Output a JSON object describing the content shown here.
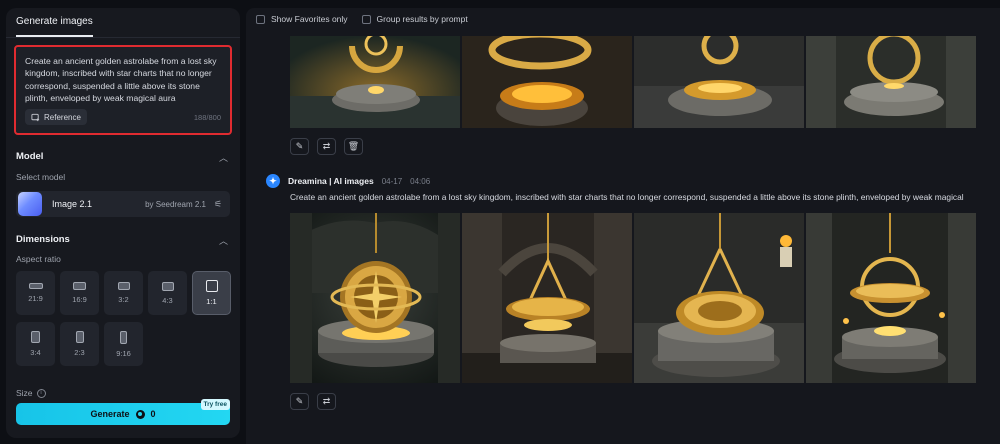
{
  "panel": {
    "tab_label": "Generate images",
    "prompt_text": "Create an ancient golden astrolabe from a lost sky kingdom, inscribed with star charts that no longer correspond, suspended a little above its stone plinth, enveloped by weak magical aura",
    "reference_label": "Reference",
    "char_count": "188/800",
    "model_title": "Model",
    "select_model_label": "Select model",
    "model_name": "Image 2.1",
    "model_provider": "by Seedream 2.1",
    "dimensions_title": "Dimensions",
    "aspect_ratio_label": "Aspect ratio",
    "aspect_ratios": [
      "21:9",
      "16:9",
      "3:2",
      "4:3",
      "1:1",
      "3:4",
      "2:3",
      "9:16"
    ],
    "selected_ratio": "1:1",
    "size_label": "Size",
    "generate_label": "Generate",
    "generate_cost": "0",
    "try_free_badge": "Try free"
  },
  "main": {
    "filters": {
      "show_favorites": "Show Favorites only",
      "group_by_prompt": "Group results by prompt"
    },
    "generation": {
      "author": "Dreamina | AI images",
      "date": "04-17",
      "time": "04:06",
      "prompt": "Create an ancient golden astrolabe from a lost sky kingdom, inscribed with star charts that no longer correspond, suspended a little above its stone plinth, enveloped by weak magical"
    }
  },
  "colors": {
    "accent": "#1fd0ee",
    "highlight_border": "#e02b30",
    "brand": "#2a86ff"
  }
}
